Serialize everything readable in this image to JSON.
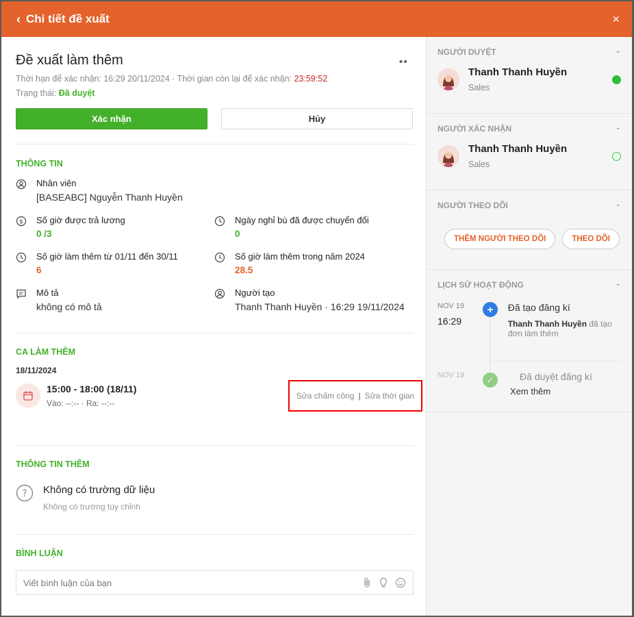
{
  "header": {
    "back_icon": "‹",
    "title": "Chi tiết đề xuất",
    "close_icon": "×"
  },
  "proposal": {
    "title": "Đề xuất làm thêm",
    "more_icon": "••",
    "deadline_label": "Thời hạn để xác nhận: 16:29 20/11/2024 · Thời gian còn lại để xác nhận: ",
    "remaining": "23:59:52",
    "status_label": "Trạng thái: ",
    "status_value": "Đã duyệt",
    "confirm_label": "Xác nhận",
    "cancel_label": "Hủy"
  },
  "info": {
    "title": "THÔNG TIN",
    "employee_label": "Nhân viên",
    "employee_value": "[BASEABC] Nguyễn Thanh Huyền",
    "paid_hours_label": "Số giờ được trả lương",
    "paid_hours_value": "0 /3",
    "converted_days_label": "Ngày nghỉ bù đã được chuyển đổi",
    "converted_days_value": "0",
    "ot_month_label": "Số giờ làm thêm từ 01/11 đến 30/11",
    "ot_month_value": "6",
    "ot_year_label": "Số giờ làm thêm trong năm 2024",
    "ot_year_value": "28.5",
    "desc_label": "Mô tả",
    "desc_value": "không có mô tả",
    "creator_label": "Người tạo",
    "creator_value": "Thanh Thanh Huyền · 16:29 19/11/2024"
  },
  "shift": {
    "title": "CA LÀM THÊM",
    "date": "18/11/2024",
    "time": "15:00 - 18:00 (18/11)",
    "checkin": "Vào: --:-- · Ra: --:--",
    "edit_attendance": "Sửa chấm công",
    "separator": "|",
    "edit_time": "Sửa thời gian"
  },
  "extra": {
    "title": "THÔNG TIN THÊM",
    "empty_title": "Không có trường dữ liệu",
    "empty_sub": "Không có trường tùy chỉnh"
  },
  "comments": {
    "title": "BÌNH LUẬN",
    "placeholder": "Viết bình luận của bạn"
  },
  "sidebar": {
    "approver_title": "NGƯỜI DUYỆT",
    "approver_name": "Thanh Thanh Huyền",
    "approver_role": "Sales",
    "confirmer_title": "NGƯỜI XÁC NHẬN",
    "confirmer_name": "Thanh Thanh Huyền",
    "confirmer_role": "Sales",
    "followers_title": "NGƯỜI THEO DÕI",
    "add_follower": "THÊM NGƯỜI THEO DÕI",
    "follow": "THEO DÕI",
    "history_title": "LỊCH SỬ HOẠT ĐỘNG",
    "history": [
      {
        "date": "NOV 19",
        "hour": "16:29",
        "title": "Đã tạo đăng kí",
        "actor": "Thanh Thanh Huyền",
        "desc": " đã tạo đơn làm thêm"
      },
      {
        "date": "NOV 19",
        "title": "Đã duyệt đăng kí"
      }
    ],
    "see_more": "Xem thêm"
  },
  "colors": {
    "brand": "#e4622c",
    "success": "#43b02a",
    "danger": "#c62828"
  }
}
